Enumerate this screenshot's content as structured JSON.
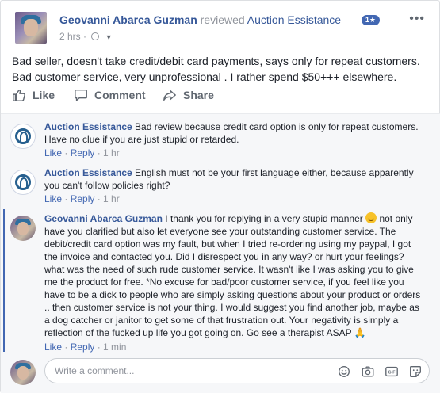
{
  "post": {
    "author": "Geovanni Abarca Guzman",
    "verb": "reviewed",
    "page": "Auction Essistance",
    "dash": "—",
    "rating": "1★",
    "time": "2 hrs ·",
    "body": "Bad seller, doesn't take credit/debit card payments, says only for repeat customers. Bad customer service, very unprofessional . I rather spend $50+++ elsewhere."
  },
  "actions": {
    "like": "Like",
    "comment": "Comment",
    "share": "Share"
  },
  "comments": [
    {
      "author": "Auction Essistance",
      "text": "Bad review because credit card option is only for repeat customers. Have no clue if you are just stupid or retarded.",
      "like": "Like",
      "sep": " · ",
      "reply": "Reply",
      "time": " · 1 hr"
    },
    {
      "author": "Auction Essistance",
      "text": "English must not be your first language either, because apparently you can't follow policies right?",
      "like": "Like",
      "sep": " · ",
      "reply": "Reply",
      "time": " · 1 hr"
    },
    {
      "author": "Geovanni Abarca Guzman",
      "text_a": "I thank you for replying in a very stupid manner",
      "text_b": "not only have you clarified but also let everyone see your outstanding customer service. The debit/credit card option was my fault, but when I tried re-ordering using my paypal, I got the invoice and contacted you. Did I disrespect you in any way? or hurt your feelings? what was the need of such rude customer service. It wasn't like I was asking you to give me the product for free. *No excuse for bad/poor customer service, if you feel like you have to be a dick to people who are simply asking questions about your product or orders .. then customer service is not your thing. I would suggest you find another job, maybe as a dog catcher or janitor to get some of that frustration out. Your negativity is simply a reflection of the fucked up life you got going on. Go see a therapist ASAP",
      "pray": "🙏",
      "like": "Like",
      "sep": " · ",
      "reply": "Reply",
      "time": " · 1 min"
    }
  ],
  "write_comment": {
    "placeholder": "Write a comment..."
  },
  "icons": [
    "more-icon",
    "globe-icon",
    "like-icon",
    "comment-icon",
    "share-icon",
    "emoji-icon",
    "camera-icon",
    "gif-icon",
    "sticker-icon"
  ],
  "colors": {
    "link": "#365899",
    "meta": "#90949c",
    "badge": "#4267b2",
    "comments_bg": "#f6f7f9"
  }
}
